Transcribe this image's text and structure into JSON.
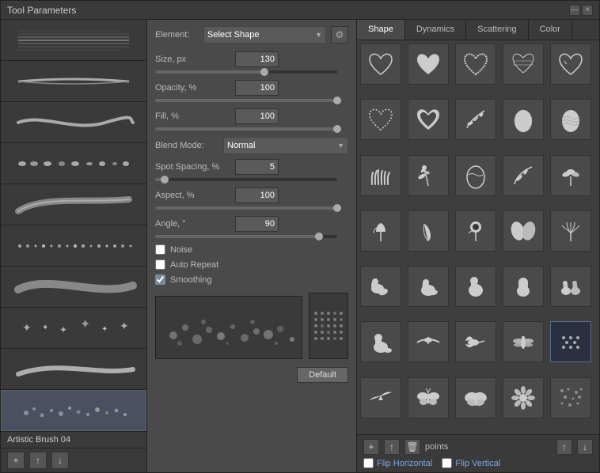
{
  "window": {
    "title": "Tool Parameters",
    "close_btn": "×",
    "min_btn": "—"
  },
  "element": {
    "label": "Element:",
    "value": "Select Shape"
  },
  "params": {
    "size_label": "Size, px",
    "size_value": "130",
    "opacity_label": "Opacity, %",
    "opacity_value": "100",
    "fill_label": "Fill, %",
    "fill_value": "100",
    "blend_label": "Blend Mode:",
    "blend_value": "Normal",
    "spot_label": "Spot Spacing, %",
    "spot_value": "5",
    "aspect_label": "Aspect, %",
    "aspect_value": "100",
    "angle_label": "Angle, °",
    "angle_value": "90",
    "noise_label": "Noise",
    "auto_repeat_label": "Auto Repeat",
    "smoothing_label": "Smoothing"
  },
  "brush_label": "Artistic Brush 04",
  "footer_btns": {
    "add": "+",
    "export": "↑",
    "import": "↓"
  },
  "tabs": {
    "shape": "Shape",
    "dynamics": "Dynamics",
    "scattering": "Scattering",
    "color": "Color"
  },
  "shape_footer": {
    "add_btn": "+",
    "up_btn": "↑",
    "trash_btn": "🗑",
    "points_label": "points",
    "sort_up": "↑",
    "sort_down": "↓",
    "flip_horizontal": "Flip Horizontal",
    "flip_vertical": "Flip Vertical"
  },
  "default_btn": "Default",
  "sliders": {
    "size_pct": 60,
    "opacity_pct": 100,
    "fill_pct": 100,
    "spot_pct": 5,
    "aspect_pct": 100,
    "angle_pct": 90
  }
}
